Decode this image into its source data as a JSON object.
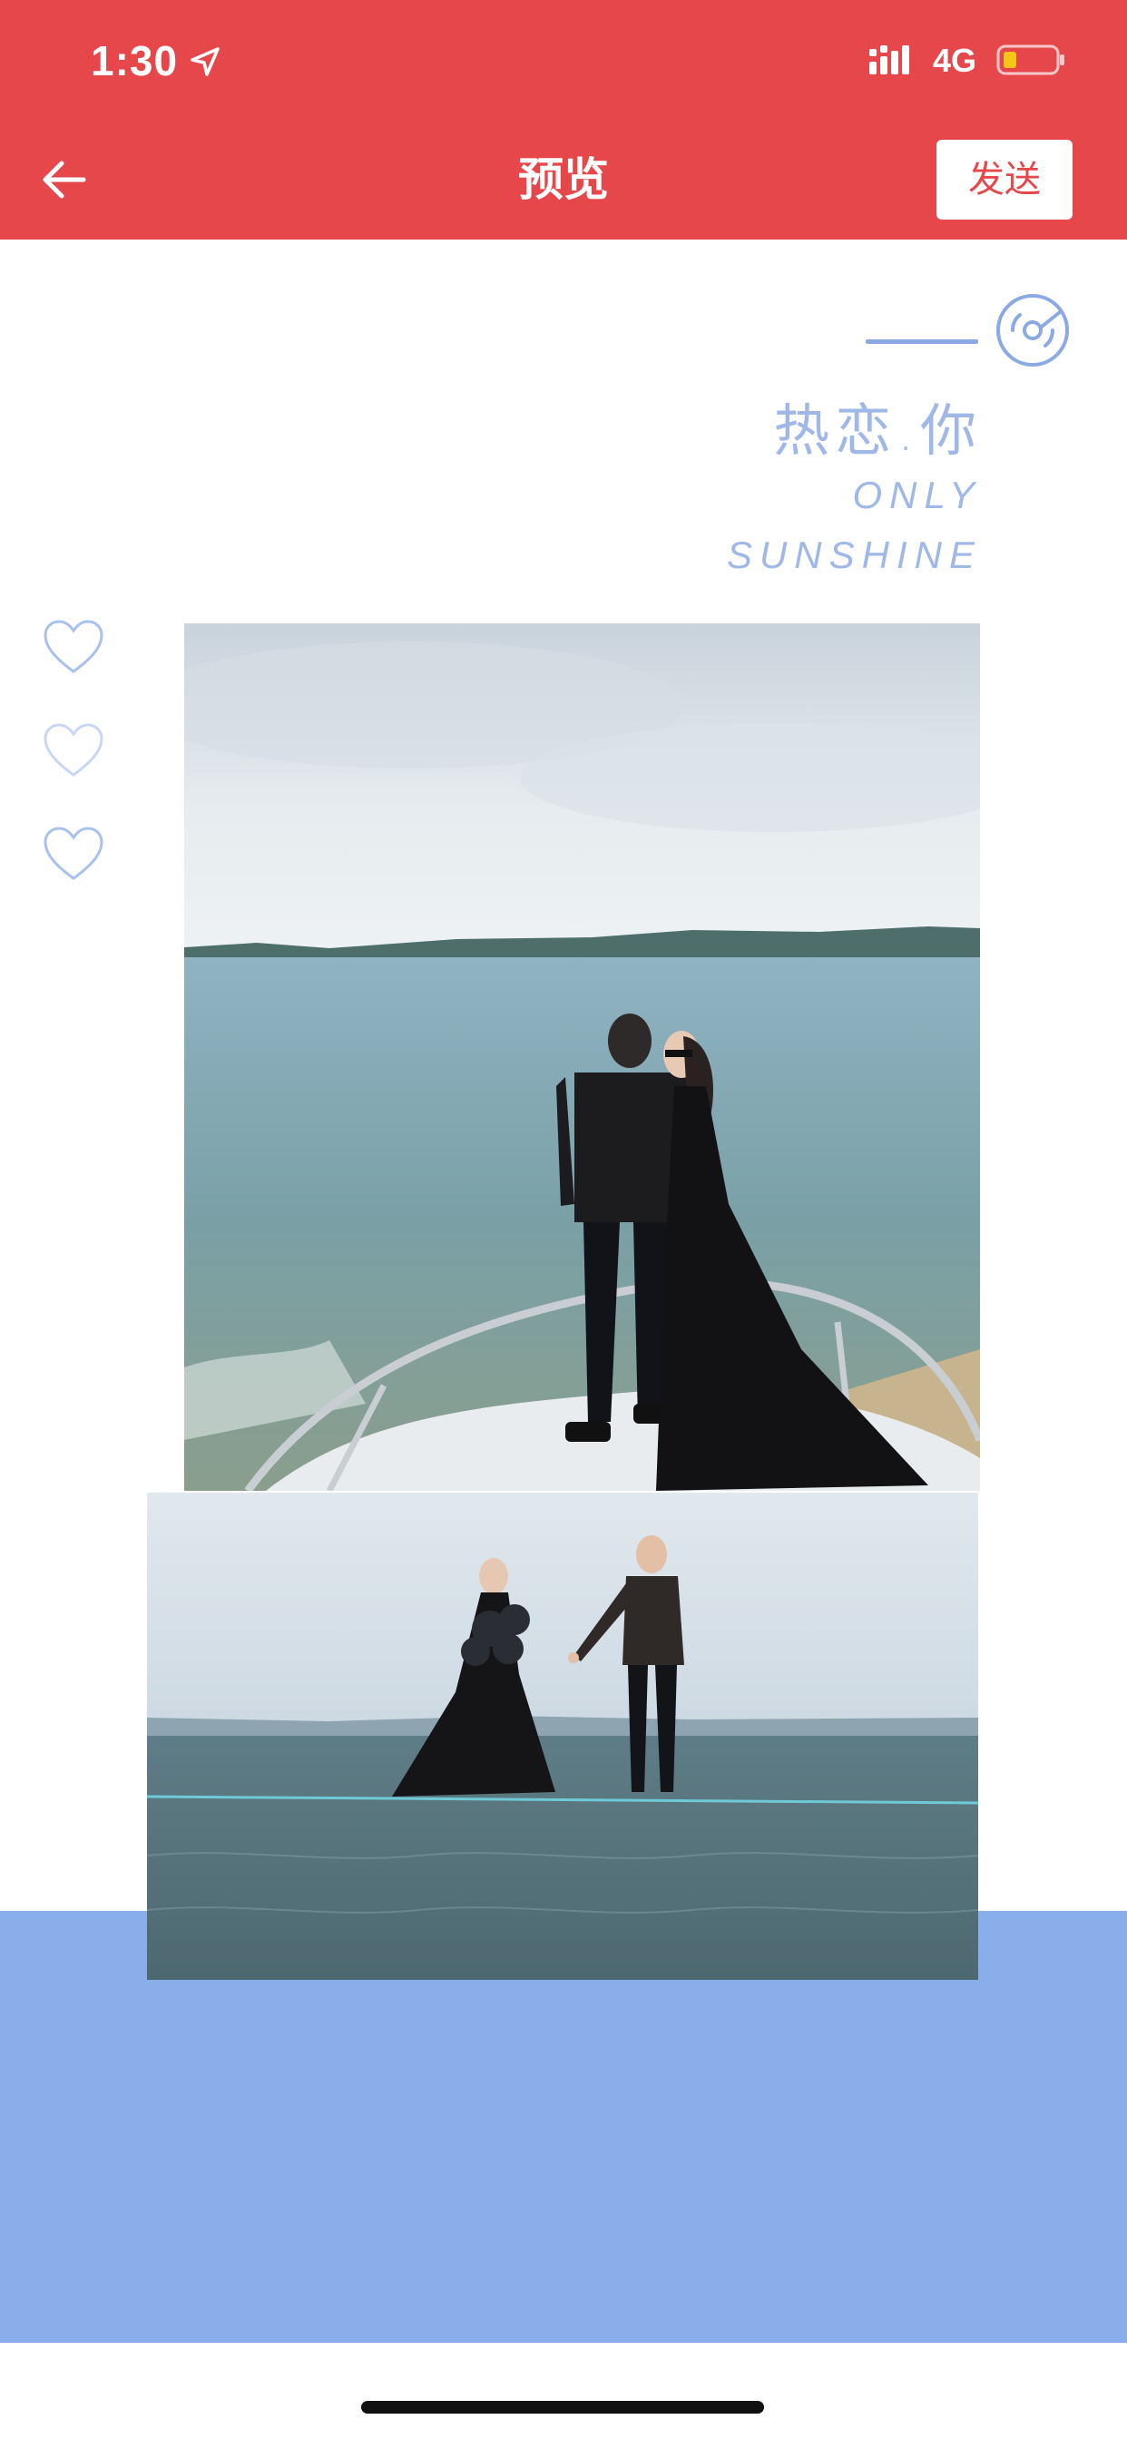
{
  "status_bar": {
    "time": "1:30",
    "network": "4G"
  },
  "nav": {
    "title": "预览",
    "send_label": "发送"
  },
  "header": {
    "title_cn": "热恋.你",
    "line1": "ONLY",
    "line2": "SUNSHINE"
  },
  "colors": {
    "accent": "#e5474b",
    "soft_blue": "#8aaeea",
    "text_blue": "#9fb8e8"
  },
  "icons": {
    "back": "arrow-left-icon",
    "music": "music-disc-icon",
    "hearts": [
      "heart-outline-icon",
      "heart-outline-icon",
      "heart-outline-icon"
    ]
  }
}
